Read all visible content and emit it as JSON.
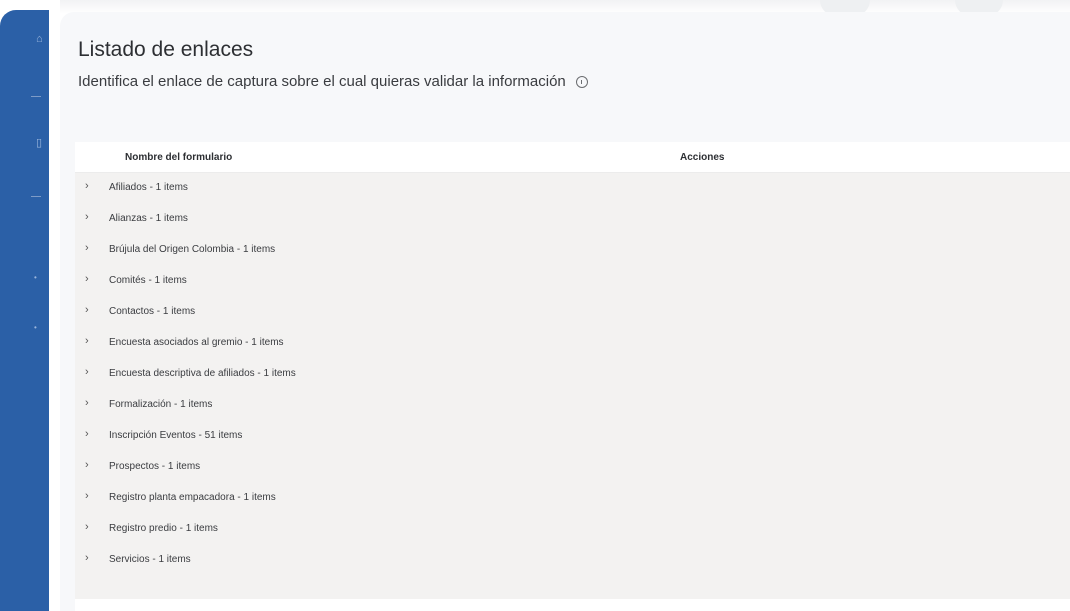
{
  "header": {
    "title": "Listado de enlaces",
    "subtitle": "Identifica el enlace de captura sobre el cual quieras validar la información"
  },
  "table": {
    "columns": [
      "Nombre del formulario",
      "Acciones"
    ],
    "rows": [
      "Afiliados - 1 items",
      "Alianzas - 1 items",
      "Brújula del Origen Colombia - 1 items",
      "Comités - 1 items",
      "Contactos - 1 items",
      "Encuesta asociados al gremio - 1 items",
      "Encuesta descriptiva de afiliados - 1 items",
      "Formalización - 1 items",
      "Inscripción Eventos - 51 items",
      "Prospectos - 1 items",
      "Registro planta empacadora - 1 items",
      "Registro predio - 1 items",
      "Servicios - 1 items"
    ]
  },
  "colors": {
    "sidebar": "#2b60a7",
    "panel": "#f7f8fa",
    "table_body": "#f3f2f1"
  },
  "icons": [
    "info-icon",
    "chevron-right-icon",
    "home-icon",
    "document-icon",
    "dot-icon"
  ]
}
